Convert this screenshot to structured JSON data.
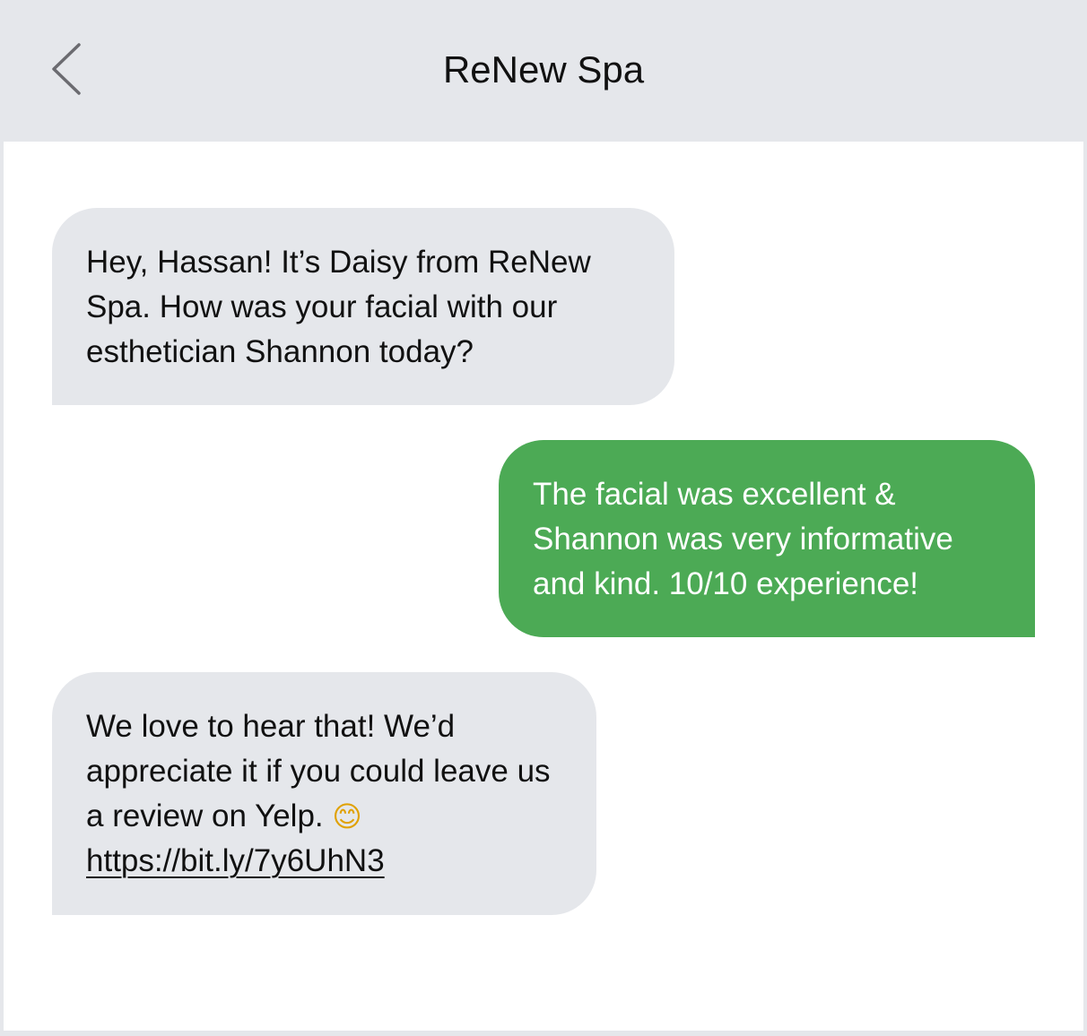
{
  "header": {
    "title": "ReNew Spa",
    "back_icon": "chevron-left-icon"
  },
  "messages": [
    {
      "direction": "incoming",
      "text": "Hey, Hassan! It’s Daisy from ReNew Spa. How was your facial with our esthetician Shannon today?"
    },
    {
      "direction": "outgoing",
      "text": "The facial was excellent & Shannon was very informative and kind. 10/10 experience!"
    },
    {
      "direction": "incoming",
      "text": "We love to hear that! We’d appreciate it if you could leave us a review on Yelp.",
      "emoji": "😊",
      "emoji_icon": "smiling-face-icon",
      "link": "https://bit.ly/7y6UhN3"
    }
  ],
  "colors": {
    "header_bg": "#e5e7eb",
    "incoming_bubble": "#e5e7eb",
    "outgoing_bubble": "#4caa55",
    "outgoing_text": "#ffffff",
    "thread_bg": "#ffffff"
  }
}
